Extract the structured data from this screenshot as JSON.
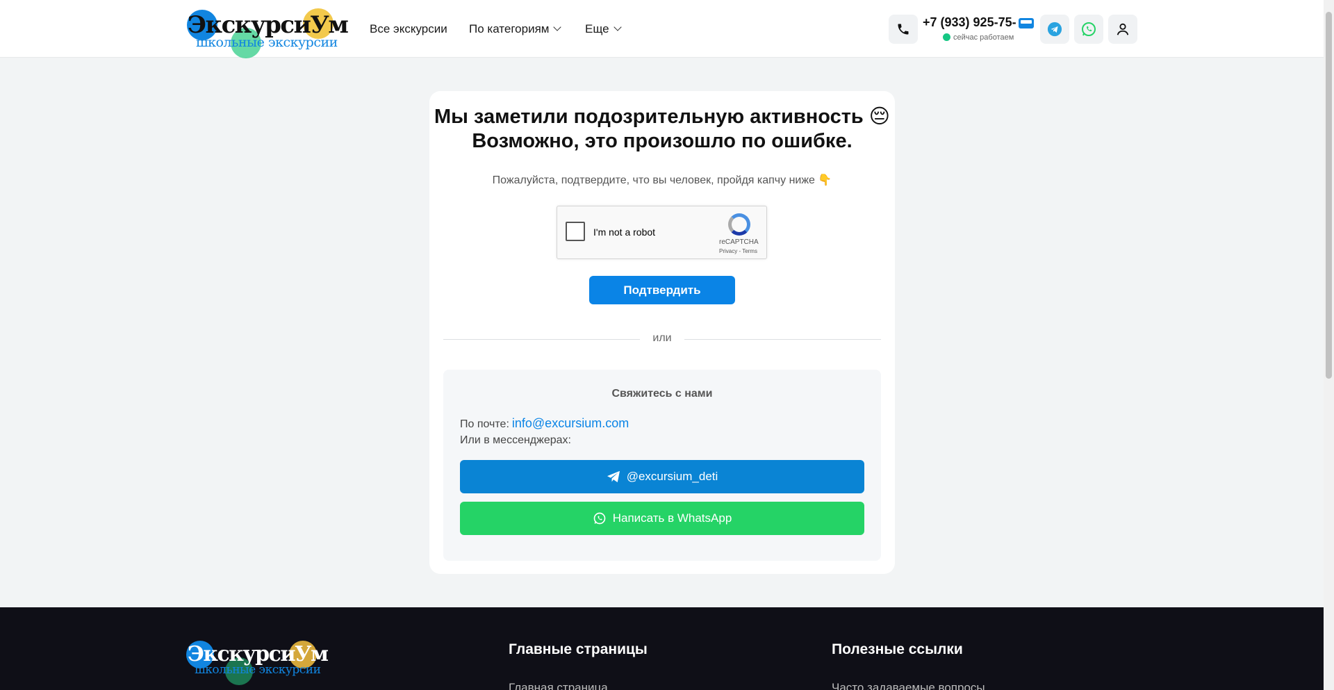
{
  "header": {
    "logo_text": "ЭкскурсиУм",
    "logo_subtext": "школьные экскурсии",
    "nav": {
      "all": "Все экскурсии",
      "categories": "По категориям",
      "more": "Еще"
    },
    "phone": "+7 (933) 925-75-",
    "status": "сейчас работаем"
  },
  "captcha_page": {
    "title_line1": "Мы заметили подозрительную активность 😔",
    "title_line2": "Возможно, это произошло по ошибке.",
    "subtitle": "Пожалуйста, подтвердите, что вы человек, пройдя капчу ниже 👇",
    "recaptcha": {
      "label": "I'm not a robot",
      "brand": "reCAPTCHA",
      "privacy_terms": "Privacy - Terms"
    },
    "confirm_label": "Подтвердить",
    "or_label": "или"
  },
  "contact": {
    "title": "Свяжитесь с нами",
    "mail_prefix": "По почте:",
    "email": "info@excursium.com",
    "messengers": "Или в мессенджерах:",
    "telegram_label": "@excursium_deti",
    "whatsapp_label": "Написать в WhatsApp"
  },
  "footer": {
    "logo_text": "ЭкскурсиУм",
    "logo_subtext": "школьные экскурсии",
    "col1_title": "Главные страницы",
    "col1_first": "Главная страница",
    "col2_title": "Полезные ссылки",
    "col2_first": "Часто задаваемые вопросы"
  },
  "colors": {
    "accent": "#0a84e6",
    "telegram": "#0a84d4",
    "whatsapp": "#25d366",
    "footer_bg": "#0f0f17"
  }
}
